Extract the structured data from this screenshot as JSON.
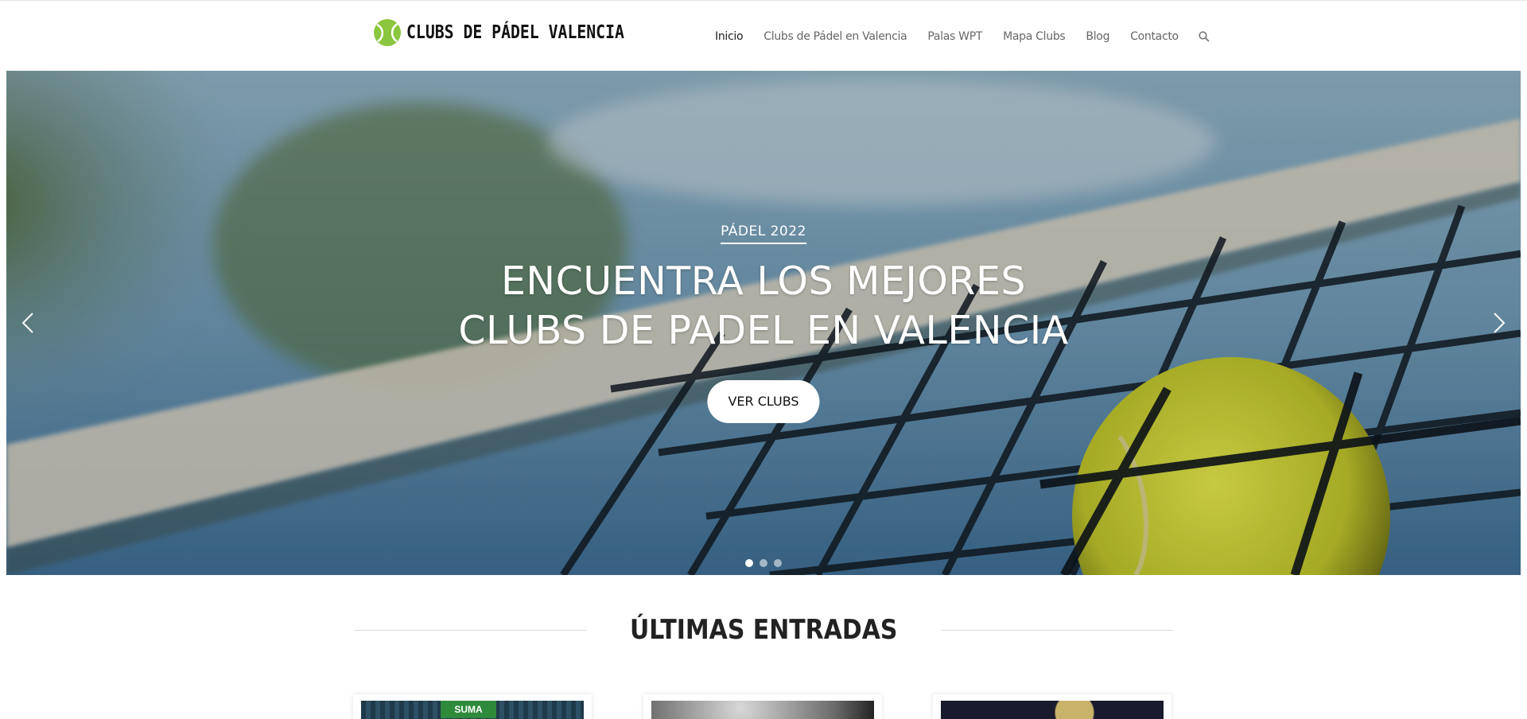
{
  "header": {
    "logo_text": "CLUBS DE PÁDEL VALENCIA",
    "logo_icon": "padel-ball-icon",
    "nav": [
      {
        "label": "Inicio",
        "active": true
      },
      {
        "label": "Clubs de Pádel en Valencia",
        "active": false
      },
      {
        "label": "Palas WPT",
        "active": false
      },
      {
        "label": "Mapa Clubs",
        "active": false
      },
      {
        "label": "Blog",
        "active": false
      },
      {
        "label": "Contacto",
        "active": false
      }
    ],
    "search_icon": "search-icon",
    "accent_color": "#7ab734"
  },
  "hero": {
    "kicker": "PÁDEL 2022",
    "title_line1": "ENCUENTRA LOS MEJORES",
    "title_line2": "CLUBS DE PADEL EN VALENCIA",
    "button_label": "VER CLUBS",
    "prev_icon": "chevron-left-icon",
    "next_icon": "chevron-right-icon",
    "slides_count": 3,
    "active_slide": 1
  },
  "latest": {
    "title": "ÚLTIMAS ENTRADAS",
    "posts": [
      {
        "thumb_text": "SUMA"
      },
      {
        "thumb_text": ""
      },
      {
        "thumb_text": ""
      }
    ]
  }
}
